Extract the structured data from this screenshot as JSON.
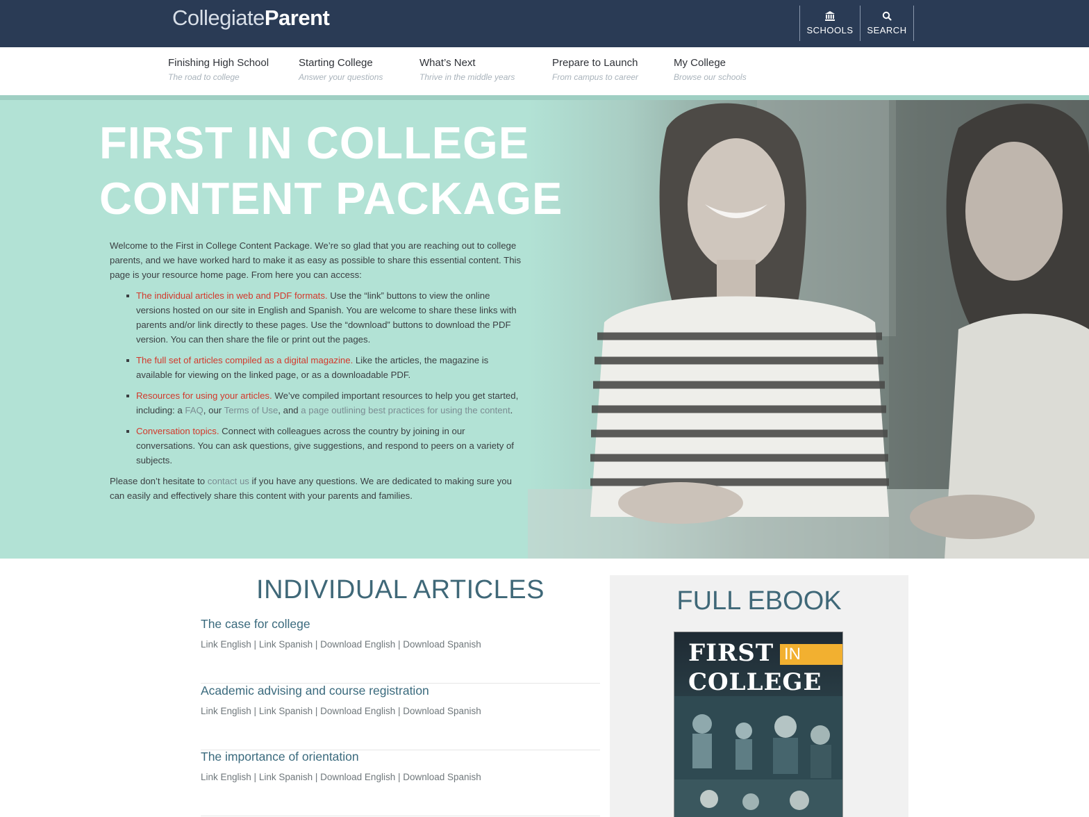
{
  "header": {
    "logo_light": "Collegiate",
    "logo_bold": "Parent",
    "buttons": [
      {
        "label": "SCHOOLS",
        "icon": "bank-icon"
      },
      {
        "label": "SEARCH",
        "icon": "search-icon"
      }
    ]
  },
  "nav": {
    "items": [
      {
        "title": "Finishing High School",
        "subtitle": "The road to college"
      },
      {
        "title": "Starting College",
        "subtitle": "Answer your questions"
      },
      {
        "title": "What’s Next",
        "subtitle": "Thrive in the middle years"
      },
      {
        "title": "Prepare to Launch",
        "subtitle": "From campus to career"
      },
      {
        "title": "My College",
        "subtitle": "Browse our schools"
      }
    ]
  },
  "hero": {
    "title_line1": "FIRST IN COLLEGE",
    "title_line2": "CONTENT PACKAGE",
    "intro": "Welcome to the First in College Content Package. We’re so glad that you are reaching out to college parents, and we have worked hard to make it as easy as possible to share this essential content. This page is your resource home page. From here you can access:",
    "bullets": [
      {
        "highlight": "The individual articles in web and PDF formats.",
        "text": " Use the “link” buttons to view the online versions hosted on our site in English and Spanish. You are welcome to share these links with parents and/or link directly to these pages. Use the “download” buttons to download the PDF version. You can then share the file or print out the pages."
      },
      {
        "highlight": "The full set of articles compiled as a digital magazine.",
        "text": " Like the articles, the magazine is available for viewing on the linked page, or as a downloadable PDF."
      },
      {
        "highlight": "Resources for using your articles.",
        "text_a": " We’ve compiled important resources to help you get started, including: a ",
        "link_faq": "FAQ",
        "text_b": ", our ",
        "link_terms": "Terms of Use",
        "text_c": ", and ",
        "link_best": "a page outlining best practices for using the content",
        "text_d": "."
      },
      {
        "highlight": "Conversation topics.",
        "text": " Connect with colleagues across the country by joining in our conversations. You can ask questions, give suggestions, and respond to peers on a variety of subjects."
      }
    ],
    "outro_a": "Please don’t hesitate to ",
    "outro_link": "contact us",
    "outro_b": " if you have any questions. We are dedicated to making sure you can easily and effectively share this content with your parents and families."
  },
  "articles": {
    "heading": "INDIVIDUAL ARTICLES",
    "link_labels": [
      "Link English",
      "Link Spanish",
      "Download English",
      "Download Spanish"
    ],
    "separator": " | ",
    "items": [
      {
        "title": "The case for college"
      },
      {
        "title": "Academic advising and course registration"
      },
      {
        "title": "The importance of orientation"
      }
    ]
  },
  "ebook": {
    "heading": "FULL EBOOK",
    "cover_first": "FIRST",
    "cover_in": "IN",
    "cover_college": "COLLEGE"
  },
  "colors": {
    "header_bg": "#2a3b55",
    "hero_bg": "#b2e2d5",
    "accent_red": "#d2382b",
    "heading_teal": "#3f6878"
  }
}
